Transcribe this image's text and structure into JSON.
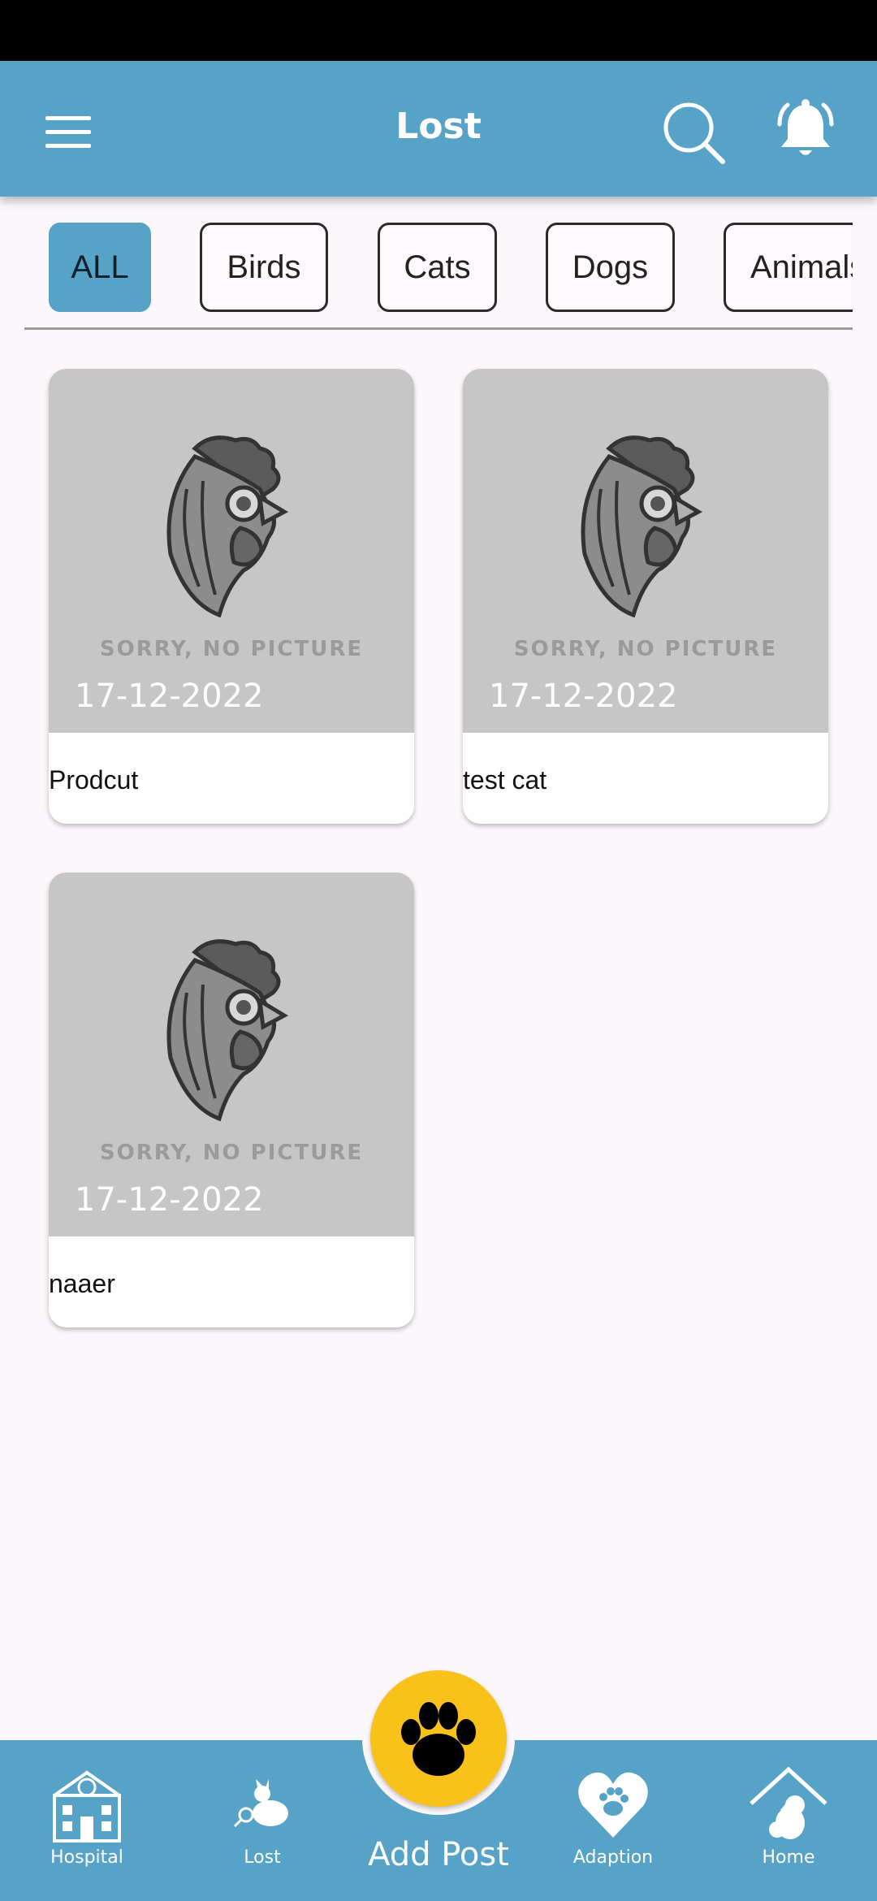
{
  "header": {
    "title": "Lost"
  },
  "filters": [
    {
      "label": "ALL",
      "active": true
    },
    {
      "label": "Birds",
      "active": false
    },
    {
      "label": "Cats",
      "active": false
    },
    {
      "label": "Dogs",
      "active": false
    },
    {
      "label": "Animals",
      "active": false
    }
  ],
  "posts": [
    {
      "placeholder": "SORRY, NO PICTURE",
      "date": "17-12-2022",
      "name": "Prodcut"
    },
    {
      "placeholder": "SORRY, NO PICTURE",
      "date": "17-12-2022",
      "name": "test cat"
    },
    {
      "placeholder": "SORRY, NO PICTURE",
      "date": "17-12-2022",
      "name": "naaer"
    }
  ],
  "bottom_nav": {
    "items": [
      {
        "label": "Hospital",
        "icon": "hospital-icon"
      },
      {
        "label": "Lost",
        "icon": "lost-pet-icon"
      },
      {
        "label": "Adaption",
        "icon": "heart-paw-icon"
      },
      {
        "label": "Home",
        "icon": "home-dog-icon"
      }
    ],
    "add_post_label": "Add Post",
    "add_post_icon": "paw-icon"
  },
  "colors": {
    "primary": "#57a3c8",
    "fab": "#f8c21a",
    "background": "#fcf7fb",
    "placeholder_bg": "#c6c6c6"
  }
}
